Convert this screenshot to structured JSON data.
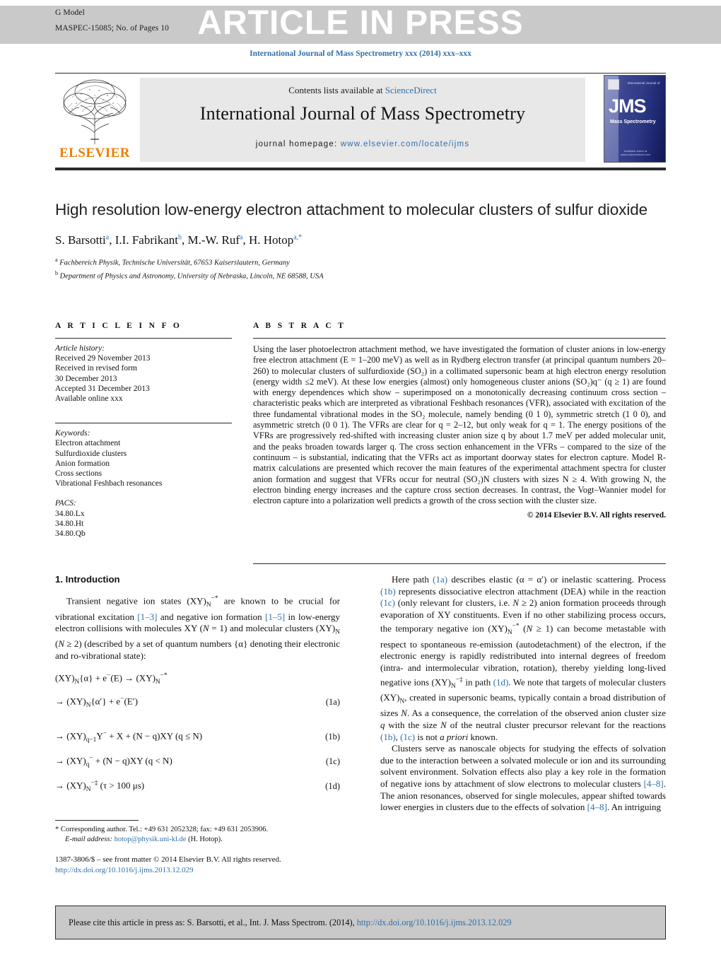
{
  "banner": {
    "g_model": "G Model",
    "maspec": "MASPEC-15085;   No. of Pages 10",
    "article_in_press": "ARTICLE IN PRESS"
  },
  "journal_line": "International Journal of Mass Spectrometry xxx (2014) xxx–xxx",
  "masthead": {
    "publisher": "ELSEVIER",
    "contents_prefix": "Contents lists available at ",
    "contents_link": "ScienceDirect",
    "journal_title": "International Journal of Mass Spectrometry",
    "homepage_prefix": "journal homepage: ",
    "homepage_url": "www.elsevier.com/locate/ijms",
    "cover": {
      "logo_text": "JMS",
      "sub_text": "Mass Spectrometry",
      "top_text": "International Journal of",
      "bottom_text": "Available online at www.sciencedirect.com"
    }
  },
  "article": {
    "title": "High resolution low-energy electron attachment to molecular clusters of sulfur dioxide",
    "authors_html": "S. Barsotti<sup>a</sup>, I.I. Fabrikant<sup>b</sup>, M.-W. Ruf<sup>a</sup>, H. Hotop<sup>a,*</sup>",
    "affiliations": [
      "Fachbereich Physik, Technische Universität, 67653 Kaiserslautern, Germany",
      "Department of Physics and Astronomy, University of Nebraska, Lincoln, NE 68588, USA"
    ],
    "affil_markers": [
      "a",
      "b"
    ]
  },
  "article_info": {
    "heading": "A R T I C L E   I N F O",
    "history_label": "Article history:",
    "history": [
      "Received 29 November 2013",
      "Received in revised form",
      "30 December 2013",
      "Accepted 31 December 2013",
      "Available online xxx"
    ],
    "keywords_label": "Keywords:",
    "keywords": [
      "Electron attachment",
      "Sulfurdioxide clusters",
      "Anion formation",
      "Cross sections",
      "Vibrational Feshbach resonances"
    ],
    "pacs_label": "PACS:",
    "pacs": [
      "34.80.Lx",
      "34.80.Ht",
      "34.80.Qb"
    ]
  },
  "abstract": {
    "heading": "A B S T R A C T",
    "text": "Using the laser photoelectron attachment method, we have investigated the formation of cluster anions in low-energy free electron attachment (E = 1–200 meV) as well as in Rydberg electron transfer (at principal quantum numbers 20–260) to molecular clusters of sulfurdioxide (SO₂) in a collimated supersonic beam at high electron energy resolution (energy width ≤2 meV). At these low energies (almost) only homogeneous cluster anions (SO₂)q⁻ (q ≥ 1) are found with energy dependences which show – superimposed on a monotonically decreasing continuum cross section – characteristic peaks which are interpreted as vibrational Feshbach resonances (VFR), associated with excitation of the three fundamental vibrational modes in the SO₂ molecule, namely bending (0 1 0), symmetric stretch (1 0 0), and asymmetric stretch (0 0 1). The VFRs are clear for q = 2–12, but only weak for q = 1. The energy positions of the VFRs are progressively red-shifted with increasing cluster anion size q by about 1.7 meV per added molecular unit, and the peaks broaden towards larger q. The cross section enhancement in the VFRs – compared to the size of the continuum – is substantial, indicating that the VFRs act as important doorway states for electron capture. Model R-matrix calculations are presented which recover the main features of the experimental attachment spectra for cluster anion formation and suggest that VFRs occur for neutral (SO₂)N clusters with sizes N ≥ 4. With growing N, the electron binding energy increases and the capture cross section decreases. In contrast, the Vogt–Wannier model for electron capture into a polarization well predicts a growth of the cross section with the cluster size.",
    "copyright": "© 2014 Elsevier B.V. All rights reserved."
  },
  "intro": {
    "heading": "1.  Introduction",
    "para1_html": "Transient negative ion states (XY)<sub>N</sub><sup>−*</sup> are known to be crucial for vibrational excitation <span class=\"lnk\">[1–3]</span> and negative ion formation <span class=\"lnk\">[1–5]</span> in low-energy electron collisions with molecules XY (<i>N</i> = 1) and molecular clusters (XY)<sub>N</sub> (<i>N</i> ≥ 2) (described by a set of quantum numbers {α} denoting their electronic and ro-vibrational state):"
  },
  "equations": [
    {
      "body_html": "(XY)<sub>N</sub>{α} + e<sup>−</sup>(E) → (XY)<sub>N</sub><sup>−*</sup>",
      "num": ""
    },
    {
      "body_html": "→ (XY)<sub>N</sub>{α′} + e<sup>−</sup>(E′)",
      "num": "(1a)"
    },
    {
      "body_html": "→ (XY)<sub>q−1</sub>Y<sup>−</sup> + X + (N − q)XY (q ≤ N)",
      "num": "(1b)"
    },
    {
      "body_html": "→ (XY)<sub>q</sub><sup>−</sup> + (N − q)XY (q &lt; N)",
      "num": "(1c)"
    },
    {
      "body_html": "→ (XY)<sub>N</sub><sup>−‡</sup> (τ > 100 μs)",
      "num": "(1d)"
    }
  ],
  "footnote": {
    "corresponding_html": "* Corresponding author. Tel.: +49 631 2052328; fax: +49 631 2053906.",
    "email_label": "E-mail address:",
    "email": "hotop@physik.uni-kl.de",
    "email_suffix": "(H. Hotop)."
  },
  "frontmatter": {
    "line1": "1387-3806/$ – see front matter © 2014 Elsevier B.V. All rights reserved.",
    "doi": "http://dx.doi.org/10.1016/j.ijms.2013.12.029"
  },
  "right_column": {
    "para1_html": "Here path <span class=\"lnk\">(1a)</span> describes elastic (α = α′) or inelastic scattering. Process <span class=\"lnk\">(1b)</span> represents dissociative electron attachment (DEA) while in the reaction <span class=\"lnk\">(1c)</span> (only relevant for clusters, i.e. <i>N</i> ≥ 2) anion formation proceeds through evaporation of XY constituents. Even if no other stabilizing process occurs, the temporary negative ion (XY)<sub>N</sub><sup>−*</sup> (<i>N</i> ≥ 1) can become metastable with respect to spontaneous re-emission (autodetachment) of the electron, if the electronic energy is rapidly redistributed into internal degrees of freedom (intra- and intermolecular vibration, rotation), thereby yielding long-lived negative ions (XY)<sub>N</sub><sup>−‡</sup> in path <span class=\"lnk\">(1d)</span>. We note that targets of molecular clusters (XY)<sub>N</sub>, created in supersonic beams, typically contain a broad distribution of sizes <i>N</i>. As a consequence, the correlation of the observed anion cluster size <i>q</i> with the size <i>N</i> of the neutral cluster precursor relevant for the reactions <span class=\"lnk\">(1b)</span>, <span class=\"lnk\">(1c)</span> is not <i>a priori</i> known.",
    "para2_html": "Clusters serve as nanoscale objects for studying the effects of solvation due to the interaction between a solvated molecule or ion and its surrounding solvent environment. Solvation effects also play a key role in the formation of negative ions by attachment of slow electrons to molecular clusters <span class=\"lnk\">[4–8]</span>. The anion resonances, observed for single molecules, appear shifted towards lower energies in clusters due to the effects of solvation <span class=\"lnk\">[4–8]</span>. An intriguing"
  },
  "cite_box": {
    "prefix": "Please cite this article in press as: S. Barsotti, et al., Int. J. Mass Spectrom. (2014), ",
    "link": "http://dx.doi.org/10.1016/j.ijms.2013.12.029"
  },
  "colors": {
    "link": "#2f6fa8",
    "banner_gray": "#c9c9c9",
    "masthead_gray": "#e8e8e8",
    "elsevier_orange": "#ef7d00"
  }
}
